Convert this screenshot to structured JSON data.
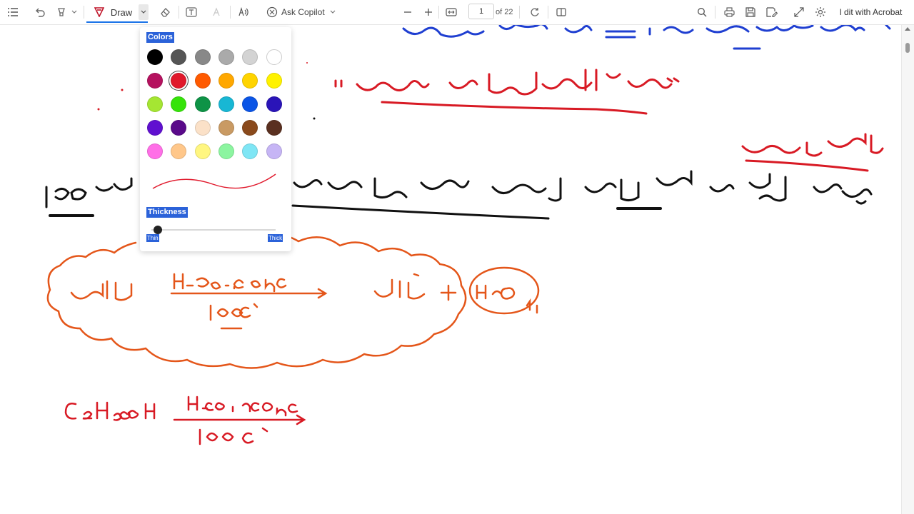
{
  "toolbar": {
    "draw_label": "Draw",
    "copilot_label": "Ask Copilot",
    "page_current": "1",
    "page_total": "of 22",
    "edit_label": "l dit with Acrobat"
  },
  "draw_popup": {
    "colors_label": "Colors",
    "thickness_label": "Thickness",
    "thin_label": "Thin",
    "thick_label": "Thick",
    "selected_color": "#e0182b",
    "thickness_level": 0.05,
    "palette": [
      [
        "#000000",
        "#555555",
        "#888888",
        "#aaaaaa",
        "#d3d3d3",
        "#ffffff"
      ],
      [
        "#b5125f",
        "#e0182b",
        "#ff5a00",
        "#ffa800",
        "#ffd400",
        "#fff200"
      ],
      [
        "#a5e632",
        "#36e30a",
        "#0e9346",
        "#18b7d4",
        "#0b55e6",
        "#2a14b8"
      ],
      [
        "#6010d0",
        "#5a0a8a",
        "#fbe1c8",
        "#c99a63",
        "#8a4a1c",
        "#5a3020"
      ],
      [
        "#ff6fe7",
        "#ffc78a",
        "#fff680",
        "#8cf5a0",
        "#7fe6f5",
        "#c6b5f5"
      ]
    ]
  },
  "document": {
    "ink_colors": {
      "blue": "#1f3fd1",
      "red": "#d81a24",
      "black": "#111111",
      "orange": "#e4561a"
    }
  }
}
